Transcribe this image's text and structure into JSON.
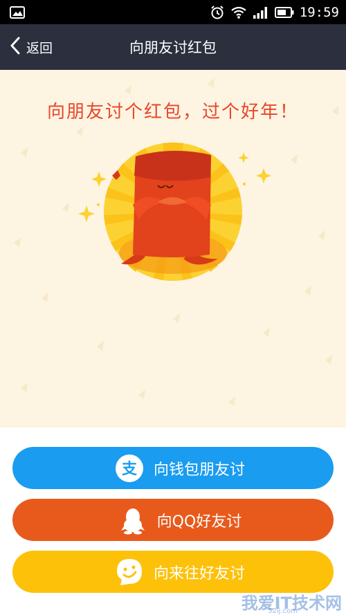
{
  "status_bar": {
    "time": "19:59",
    "icons": [
      "image-icon",
      "alarm-icon",
      "wifi-icon",
      "signal-icon",
      "battery-icon"
    ]
  },
  "nav": {
    "back_label": "返回",
    "title": "向朋友讨红包"
  },
  "banner": {
    "headline": "向朋友讨个红包，过个好年！",
    "background_color": "#fdf4e2",
    "headline_color": "#e8462a"
  },
  "actions": [
    {
      "label": "向钱包朋友讨",
      "icon": "alipay-icon",
      "color": "#1a9cf0"
    },
    {
      "label": "向QQ好友讨",
      "icon": "qq-penguin-icon",
      "color": "#e85a1c"
    },
    {
      "label": "向来往好友讨",
      "icon": "laiwang-smile-icon",
      "color": "#fdc10a"
    }
  ],
  "watermark": {
    "text": "我爱IT技术网",
    "sub": "52ij.com"
  }
}
